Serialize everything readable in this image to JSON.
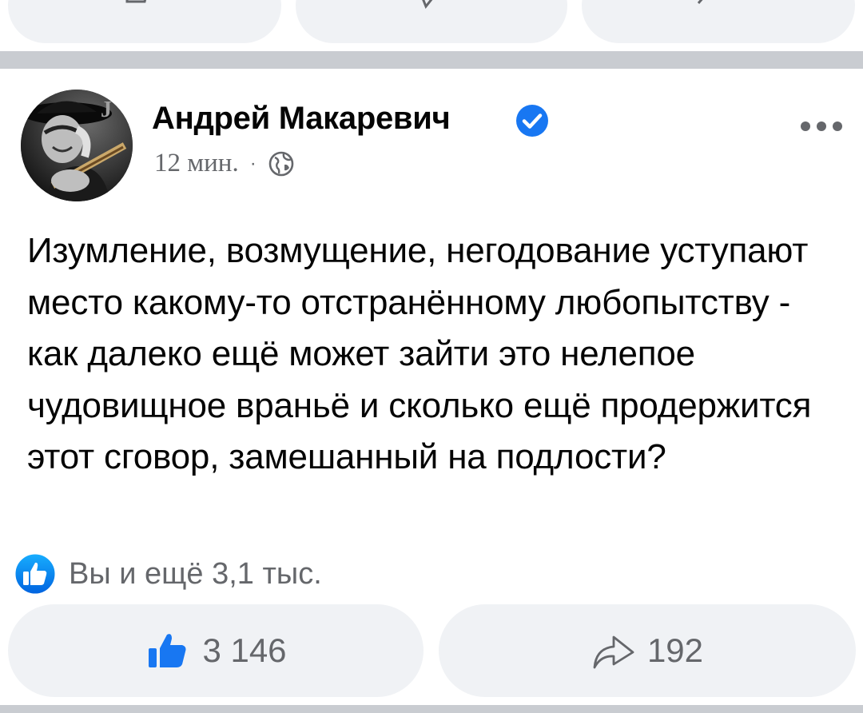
{
  "post": {
    "author": "Андрей Макаревич",
    "time": "12 мин.",
    "separator": "·",
    "text": "Изумление, возмущение, негодование уступают место какому-то отстранённому любопытству - как далеко ещё может зайти это нелепое чудовищное враньё и сколько ещё продержится этот сговор, замешанный на подлости?",
    "reactions_summary": "Вы и ещё 3,1 тыс.",
    "likes_count": "3 146",
    "shares_count": "192"
  },
  "icons": {
    "verified": "verified-badge-icon",
    "audience": "globe-icon",
    "more": "more-options-icon",
    "like": "thumbs-up-icon",
    "share": "share-arrow-icon"
  },
  "colors": {
    "accent": "#1877f2",
    "text": "#050505",
    "secondary": "#65676b",
    "pill_bg": "#f0f2f5",
    "separator": "#c9ccd1"
  }
}
